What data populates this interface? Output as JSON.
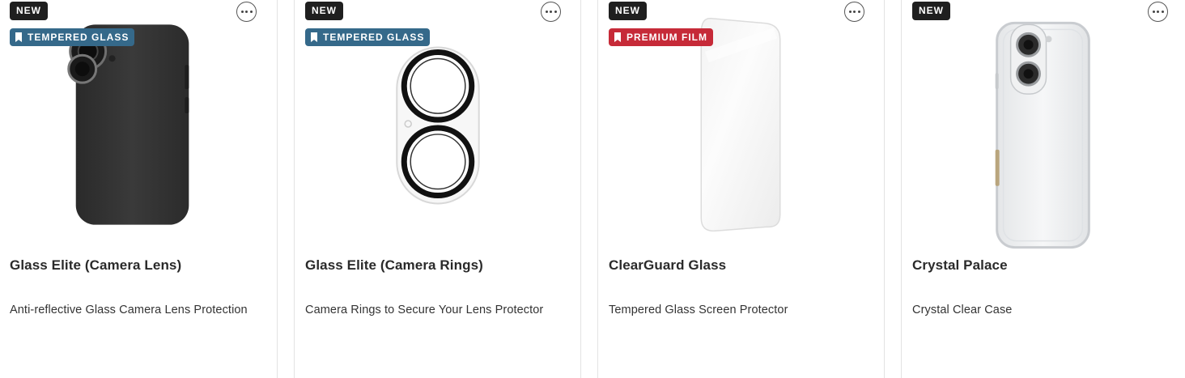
{
  "products": [
    {
      "new_badge": "NEW",
      "type_badge": "TEMPERED GLASS",
      "title": "Glass Elite (Camera Lens)",
      "subtitle": "Anti-reflective Glass Camera Lens Protection",
      "type_color": "#35698a"
    },
    {
      "new_badge": "NEW",
      "type_badge": "TEMPERED GLASS",
      "title": "Glass Elite (Camera Rings)",
      "subtitle": "Camera Rings to Secure Your Lens Protector",
      "type_color": "#35698a"
    },
    {
      "new_badge": "NEW",
      "type_badge": "PREMIUM FILM",
      "title": "ClearGuard Glass",
      "subtitle": "Tempered Glass Screen Protector",
      "type_color": "#c62a38"
    },
    {
      "new_badge": "NEW",
      "type_badge": "",
      "title": "Crystal Palace",
      "subtitle": "Crystal Clear Case"
    }
  ],
  "icons": {
    "more": "more-options-icon",
    "bookmark": "bookmark-icon"
  }
}
